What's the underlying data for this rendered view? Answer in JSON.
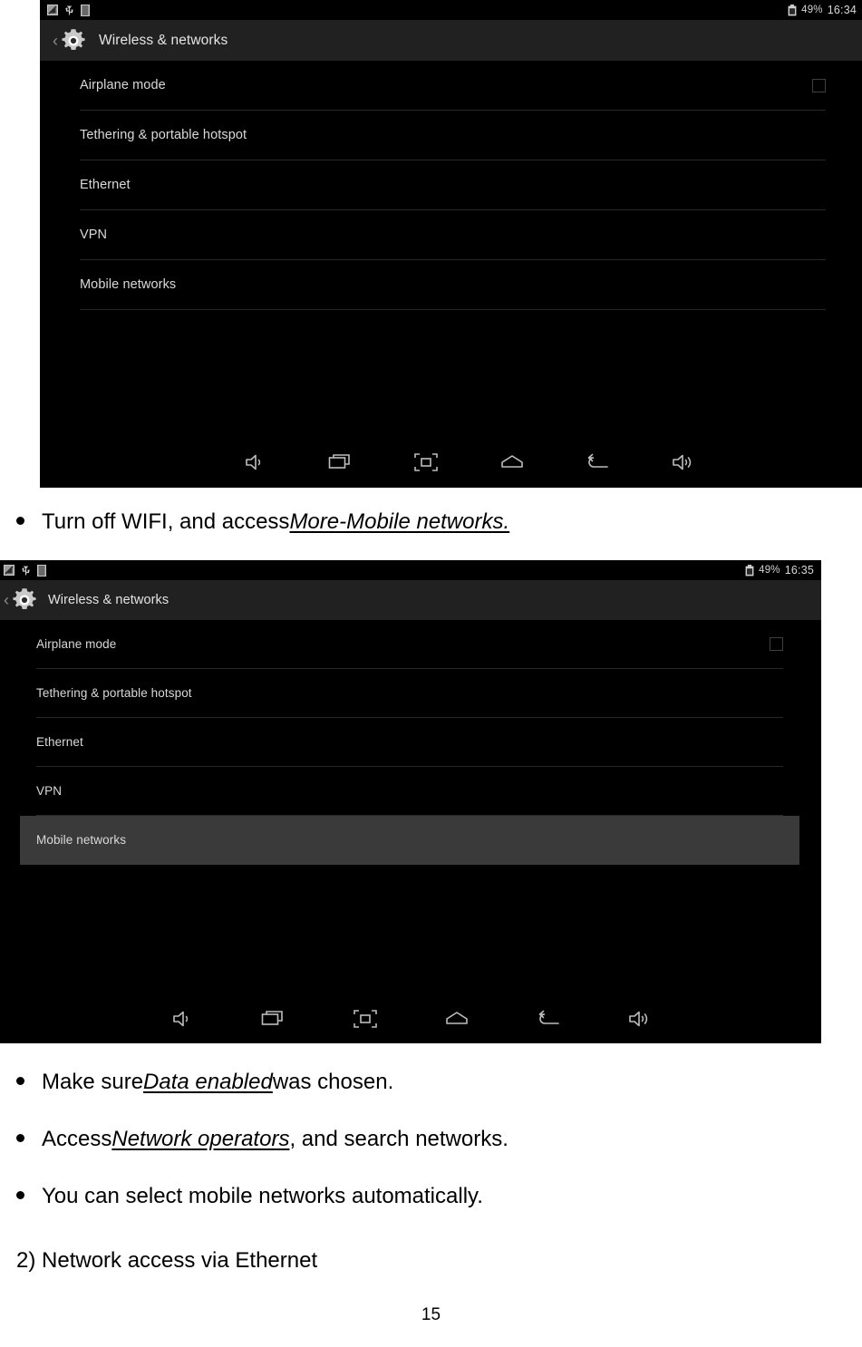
{
  "page": {
    "number": "15"
  },
  "screenshot_1": {
    "status_bar": {
      "icons": [
        "no-signal-icon",
        "usb-icon",
        "sim-card-icon"
      ],
      "battery_percent": "49%",
      "clock": "16:34"
    },
    "action_bar": {
      "back_chevron": "‹",
      "icon": "settings-gear-icon",
      "title": "Wireless & networks"
    },
    "list": {
      "items": [
        {
          "label": "Airplane mode",
          "control": "checkbox",
          "checked": false,
          "selected": false
        },
        {
          "label": "Tethering & portable hotspot",
          "control": "none",
          "selected": false
        },
        {
          "label": "Ethernet",
          "control": "none",
          "selected": false
        },
        {
          "label": "VPN",
          "control": "none",
          "selected": false
        },
        {
          "label": "Mobile networks",
          "control": "none",
          "selected": false
        }
      ]
    },
    "nav_bar": {
      "buttons": [
        "volume-down-icon",
        "recent-apps-icon",
        "screenshot-icon",
        "home-icon",
        "back-icon",
        "volume-up-icon"
      ]
    }
  },
  "screenshot_2": {
    "status_bar": {
      "icons": [
        "no-signal-icon",
        "usb-icon",
        "sim-card-icon"
      ],
      "battery_percent": "49%",
      "clock": "16:35"
    },
    "action_bar": {
      "back_chevron": "‹",
      "icon": "settings-gear-icon",
      "title": "Wireless & networks"
    },
    "list": {
      "items": [
        {
          "label": "Airplane mode",
          "control": "checkbox",
          "checked": false,
          "selected": false
        },
        {
          "label": "Tethering & portable hotspot",
          "control": "none",
          "selected": false
        },
        {
          "label": "Ethernet",
          "control": "none",
          "selected": false
        },
        {
          "label": "VPN",
          "control": "none",
          "selected": false
        },
        {
          "label": "Mobile networks",
          "control": "none",
          "selected": true
        }
      ]
    },
    "nav_bar": {
      "buttons": [
        "volume-down-icon",
        "recent-apps-icon",
        "screenshot-icon",
        "home-icon",
        "back-icon",
        "volume-up-icon"
      ]
    }
  },
  "body": {
    "bullet_1": {
      "before": "Turn off WIFI, and access ",
      "emphasis": "More-Mobile networks.",
      "after": ""
    },
    "bullet_2": {
      "before": "Make sure ",
      "emphasis": "Data enabled",
      "after": " was chosen."
    },
    "bullet_3": {
      "before": "Access ",
      "emphasis": "Network operators",
      "after": ", and search networks."
    },
    "bullet_4": {
      "before": "You can select mobile networks automatically.",
      "emphasis": "",
      "after": ""
    },
    "section_heading": "2) Network access via Ethernet"
  },
  "colors": {
    "screen_background": "#000000",
    "action_bar": "#212121",
    "selected_row": "#3a3a3a",
    "list_text": "#d9d9d9",
    "divider": "#282828"
  }
}
